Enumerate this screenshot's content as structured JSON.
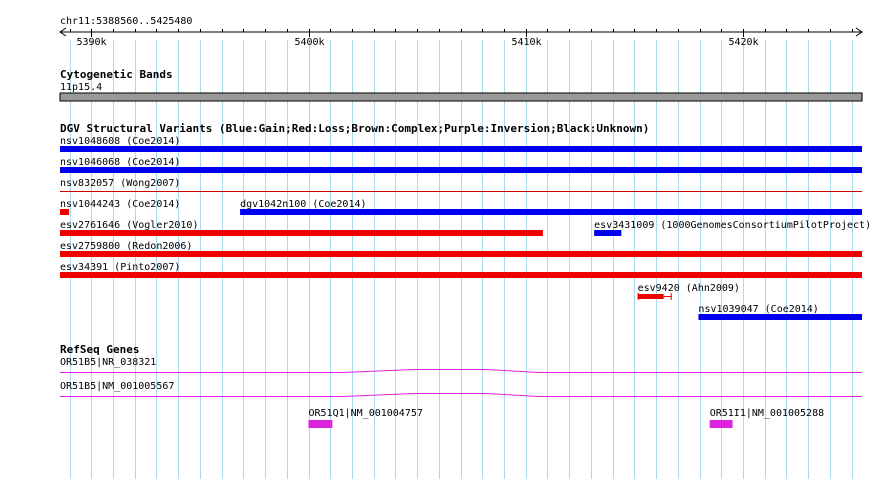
{
  "region": {
    "label": "chr11:5388560..5425480",
    "start": 5388560,
    "end": 5425480,
    "ticks": [
      {
        "pos": 5390000,
        "label": "5390k"
      },
      {
        "pos": 5400000,
        "label": "5400k"
      },
      {
        "pos": 5410000,
        "label": "5410k"
      },
      {
        "pos": 5420000,
        "label": "5420k"
      }
    ],
    "minor_step": 1000
  },
  "colors": {
    "grid": "#a8dcec",
    "gain": "#0000ee",
    "loss": "#ee0000",
    "band": "#999999",
    "gene": "#dd22dd",
    "thin_line": "#cc0000"
  },
  "cytoband": {
    "title": "Cytogenetic Bands",
    "band_label": "11p15.4"
  },
  "dgv": {
    "title": "DGV Structural Variants (Blue:Gain;Red:Loss;Brown:Complex;Purple:Inversion;Black:Unknown)",
    "features": [
      {
        "label": "nsv1048608 (Coe2014)",
        "type": "gain",
        "start": 5388560,
        "end": 5425480,
        "row": 0,
        "style": "bar"
      },
      {
        "label": "nsv1046068 (Coe2014)",
        "type": "gain",
        "start": 5388560,
        "end": 5425480,
        "row": 1,
        "style": "bar"
      },
      {
        "label": "nsv832057 (Wong2007)",
        "type": "loss",
        "start": 5388560,
        "end": 5425480,
        "row": 2,
        "style": "line"
      },
      {
        "label": "nsv1044243 (Coe2014)",
        "type": "loss",
        "start": 5388560,
        "end": 5388980,
        "row": 3,
        "style": "bar"
      },
      {
        "label": "dgv1042n100 (Coe2014)",
        "type": "gain",
        "start": 5396850,
        "end": 5425480,
        "row": 3,
        "style": "bar"
      },
      {
        "label": "esv2761646 (Vogler2010)",
        "type": "loss",
        "start": 5388560,
        "end": 5410790,
        "row": 4,
        "style": "bar"
      },
      {
        "label": "esv3431009 (1000GenomesConsortiumPilotProject)",
        "type": "gain",
        "start": 5413150,
        "end": 5414400,
        "row": 4,
        "style": "bar"
      },
      {
        "label": "esv2759800 (Redon2006)",
        "type": "loss",
        "start": 5388560,
        "end": 5425480,
        "row": 5,
        "style": "bar"
      },
      {
        "label": "esv34391 (Pinto2007)",
        "type": "loss",
        "start": 5388560,
        "end": 5425480,
        "row": 6,
        "style": "bar"
      },
      {
        "label": "esv9420 (Ahn2009)",
        "type": "loss",
        "start": 5415150,
        "end": 5416720,
        "row": 7,
        "style": "bracket",
        "core_end": 5416350
      },
      {
        "label": "nsv1039047 (Coe2014)",
        "type": "gain",
        "start": 5417950,
        "end": 5425480,
        "row": 8,
        "style": "bar"
      }
    ]
  },
  "refseq": {
    "title": "RefSeq Genes",
    "transcripts": [
      {
        "label": "OR51B5|NR_038321",
        "start": 5388560,
        "end": 5425480,
        "row": 0,
        "style": "intron"
      },
      {
        "label": "OR51B5|NM_001005567",
        "start": 5388560,
        "end": 5425480,
        "row": 1,
        "style": "intron"
      },
      {
        "label": "OR51Q1|NM_001004757",
        "start": 5400000,
        "end": 5401100,
        "row": 2,
        "style": "exon"
      },
      {
        "label": "OR51I1|NM_001005288",
        "start": 5418470,
        "end": 5419520,
        "row": 2,
        "style": "exon"
      }
    ]
  }
}
